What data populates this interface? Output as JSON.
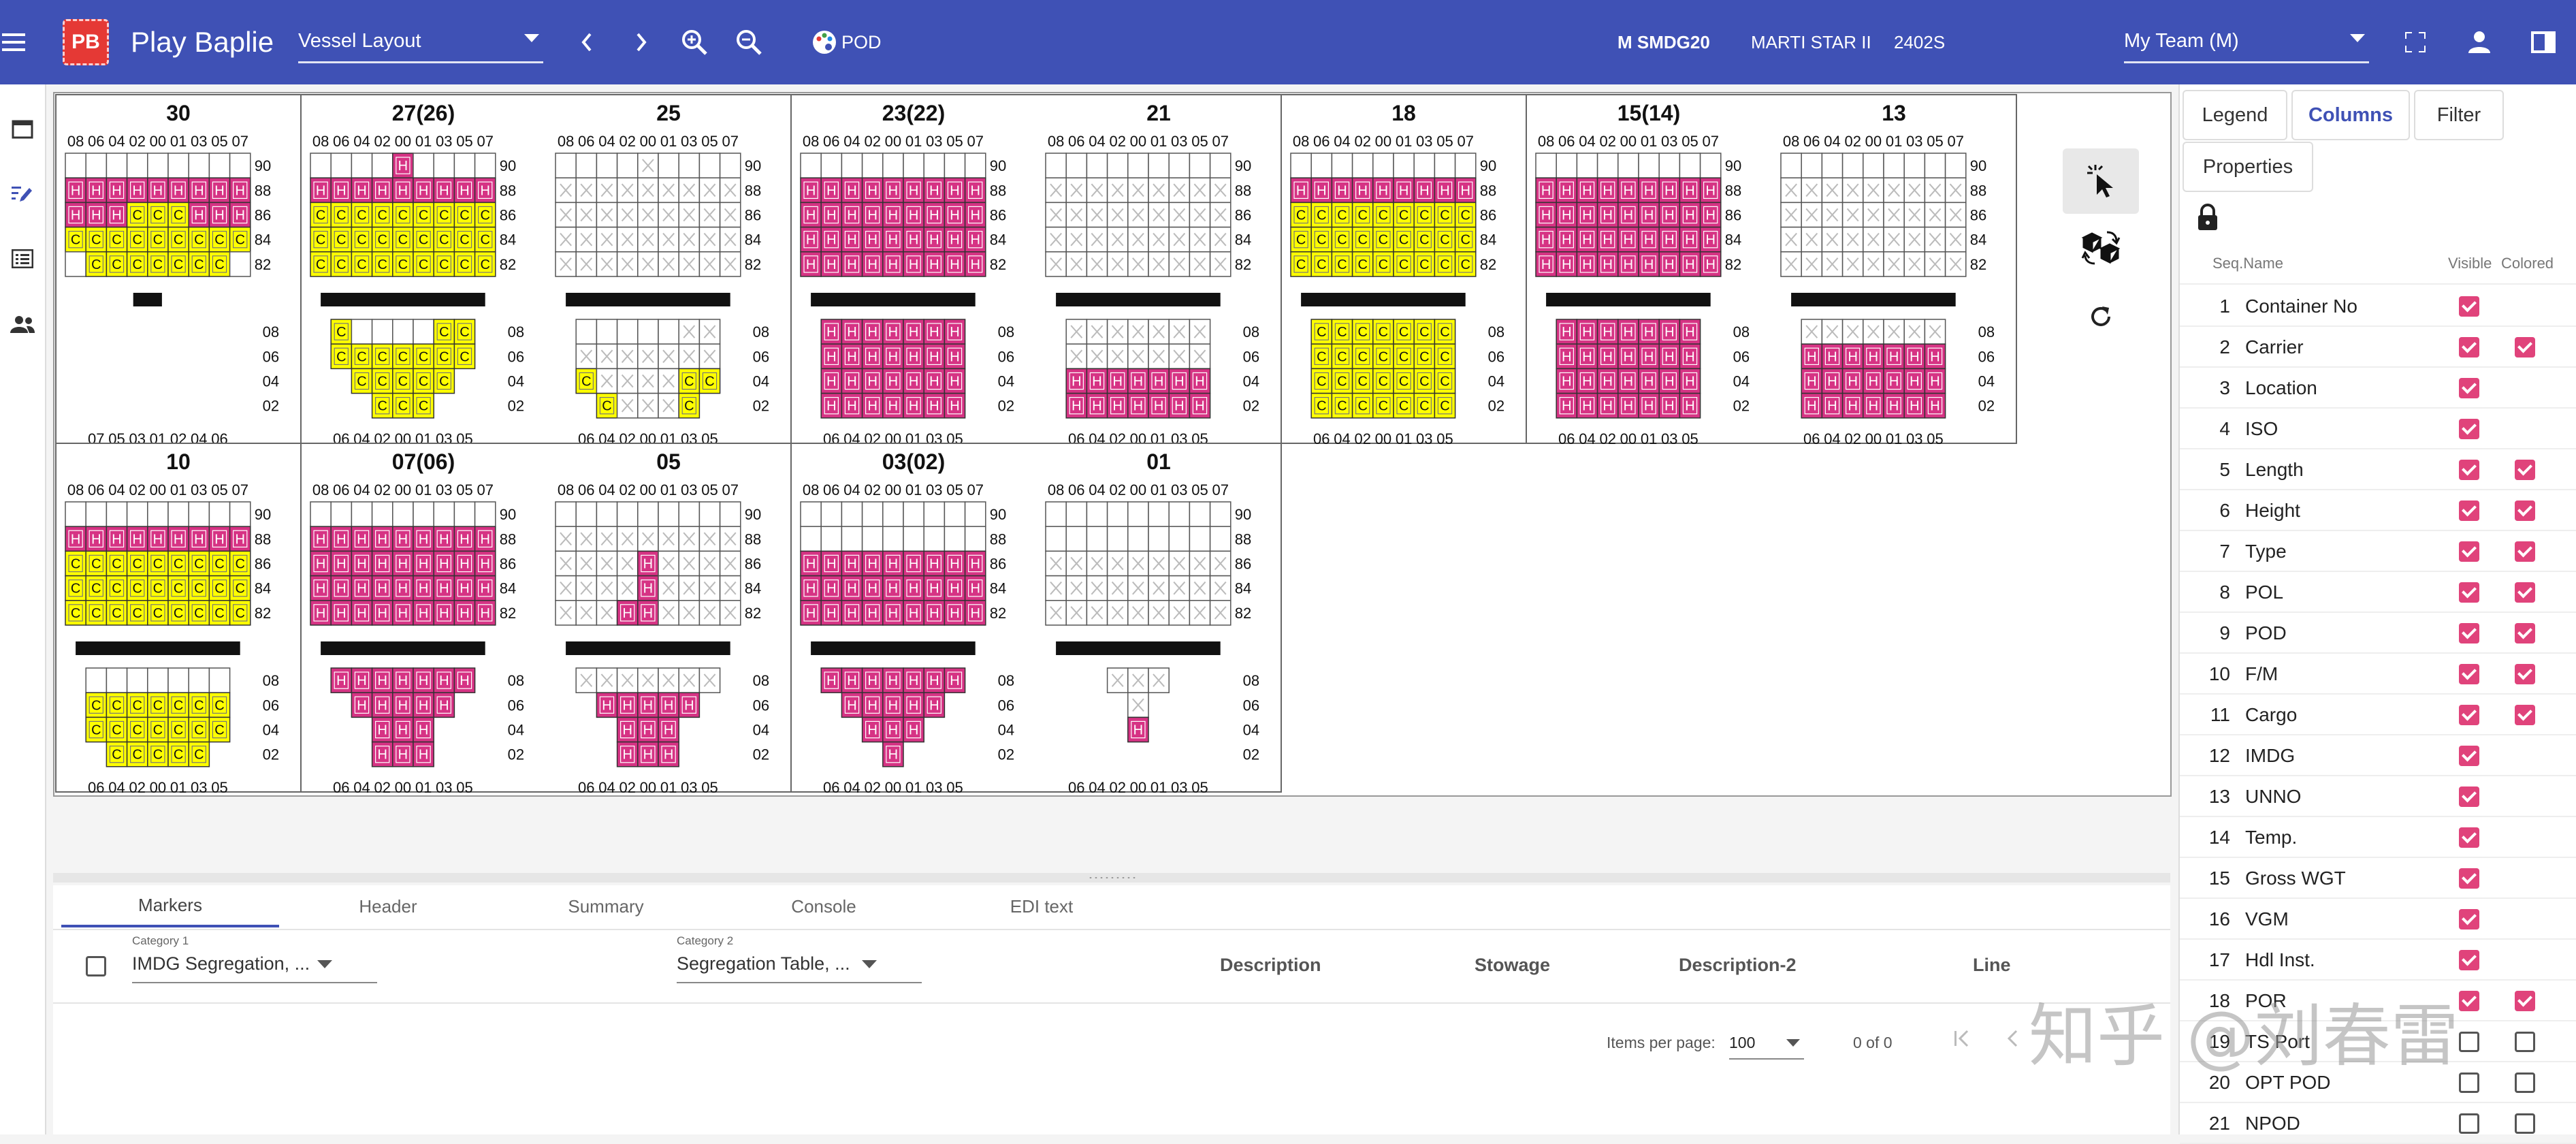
{
  "app": {
    "logo": "PB",
    "title": "Play Baplie",
    "view_select": "Vessel Layout",
    "pod_label": "POD",
    "vessel_code": "M SMDG20",
    "vessel_name": "MARTI STAR II",
    "voyage": "2402S",
    "team": "My Team (M)"
  },
  "colors": {
    "topbar": "#3f51b5",
    "hazard": "#d63384",
    "yellow": "#ffff00",
    "accent": "#e0437b"
  },
  "icons": {
    "menu": "menu-icon",
    "prev": "chevron-left-icon",
    "next": "chevron-right-icon",
    "zoom_in": "zoom-in-icon",
    "zoom_out": "zoom-out-icon",
    "palette": "palette-icon",
    "fullscreen": "fullscreen-icon",
    "user": "account-icon",
    "panel": "right-panel-icon"
  },
  "bays_row1": [
    {
      "title": "30",
      "wide": true,
      "deck": {
        "cols": [
          "08",
          "06",
          "04",
          "02",
          "00",
          "01",
          "03",
          "05",
          "07"
        ],
        "tiers": [
          "90",
          "88",
          "86",
          "84",
          "82"
        ],
        "grid": [
          "EEEEEEEEE",
          "HHHHHHHHH",
          "HHHYYYHHH",
          "YYYYYYYYY",
          "EYYYYYYYE"
        ]
      },
      "hold": {
        "cols": [
          "07",
          "05",
          "03",
          "01",
          "02",
          "04",
          "06"
        ],
        "tiers": [
          "08",
          "06",
          "04",
          "02"
        ],
        "grid": []
      }
    },
    {
      "title": "27(26)",
      "wide": false,
      "deck": {
        "cols": [
          "08",
          "06",
          "04",
          "02",
          "00",
          "01",
          "03",
          "05",
          "07"
        ],
        "tiers": [
          "90",
          "88",
          "86",
          "84",
          "82"
        ],
        "grid": [
          "EEEEHEEEE",
          "HHHHHHHHH",
          "YYYYYYYYY",
          "YYYYYYYYY",
          "YYYYYYYYY"
        ]
      },
      "hold": {
        "cols": [
          "06",
          "04",
          "02",
          "00",
          "01",
          "03",
          "05"
        ],
        "tiers": [
          "08",
          "06",
          "04",
          "02"
        ],
        "grid": [
          "YEEEEYY",
          "YYYYYYY",
          "-YYYYY-",
          "--YYY--"
        ]
      }
    },
    {
      "title": "25",
      "wide": false,
      "deck": {
        "cols": [
          "08",
          "06",
          "04",
          "02",
          "00",
          "01",
          "03",
          "05",
          "07"
        ],
        "tiers": [
          "90",
          "88",
          "86",
          "84",
          "82"
        ],
        "grid": [
          "EEEEXEEEE",
          "XXXXXXXXX",
          "XXXXXXXXX",
          "XXXXXXXXX",
          "XXXXXXXXX"
        ]
      },
      "hold": {
        "cols": [
          "06",
          "04",
          "02",
          "00",
          "01",
          "03",
          "05"
        ],
        "tiers": [
          "08",
          "06",
          "04",
          "02"
        ],
        "grid": [
          "EEEEEXX",
          "XXXXXXX",
          "YXXXXYY",
          "-YXXXY-"
        ]
      }
    },
    {
      "title": "23(22)",
      "wide": false,
      "deck": {
        "cols": [
          "08",
          "06",
          "04",
          "02",
          "00",
          "01",
          "03",
          "05",
          "07"
        ],
        "tiers": [
          "90",
          "88",
          "86",
          "84",
          "82"
        ],
        "grid": [
          "EEEEEEEEE",
          "HHHHHHHHH",
          "HHHHHHHHH",
          "HHHHHHHHH",
          "HHHHHHHHH"
        ]
      },
      "hold": {
        "cols": [
          "06",
          "04",
          "02",
          "00",
          "01",
          "03",
          "05"
        ],
        "tiers": [
          "08",
          "06",
          "04",
          "02"
        ],
        "grid": [
          "HHHHHHH",
          "HHHHHHH",
          "HHHHHHH",
          "HHHHHHH"
        ]
      }
    },
    {
      "title": "21",
      "wide": false,
      "deck": {
        "cols": [
          "08",
          "06",
          "04",
          "02",
          "00",
          "01",
          "03",
          "05",
          "07"
        ],
        "tiers": [
          "90",
          "88",
          "86",
          "84",
          "82"
        ],
        "grid": [
          "EEEEEEEEE",
          "XXXXXXXXX",
          "XXXXXXXXX",
          "XXXXXXXXX",
          "XXXXXXXXX"
        ]
      },
      "hold": {
        "cols": [
          "06",
          "04",
          "02",
          "00",
          "01",
          "03",
          "05"
        ],
        "tiers": [
          "08",
          "06",
          "04",
          "02"
        ],
        "grid": [
          "XXXXXXX",
          "XXXXXXX",
          "HHHHHHH",
          "HHHHHHH"
        ]
      }
    },
    {
      "title": "18",
      "wide": true,
      "deck": {
        "cols": [
          "08",
          "06",
          "04",
          "02",
          "00",
          "01",
          "03",
          "05",
          "07"
        ],
        "tiers": [
          "90",
          "88",
          "86",
          "84",
          "82"
        ],
        "grid": [
          "EEEEEEEEE",
          "HHHHHHHHH",
          "YYYYYYYYY",
          "YYYYYYYYY",
          "YYYYYYYYY"
        ]
      },
      "hold": {
        "cols": [
          "06",
          "04",
          "02",
          "00",
          "01",
          "03",
          "05"
        ],
        "tiers": [
          "08",
          "06",
          "04",
          "02"
        ],
        "grid": [
          "YYYYYYY",
          "YYYYYYY",
          "YYYYYYY",
          "YYYYYYY"
        ]
      }
    },
    {
      "title": "15(14)",
      "wide": false,
      "deck": {
        "cols": [
          "08",
          "06",
          "04",
          "02",
          "00",
          "01",
          "03",
          "05",
          "07"
        ],
        "tiers": [
          "90",
          "88",
          "86",
          "84",
          "82"
        ],
        "grid": [
          "EEEEEEEEE",
          "HHHHHHHHH",
          "HHHHHHHHH",
          "HHHHHHHHH",
          "HHHHHHHHH"
        ]
      },
      "hold": {
        "cols": [
          "06",
          "04",
          "02",
          "00",
          "01",
          "03",
          "05"
        ],
        "tiers": [
          "08",
          "06",
          "04",
          "02"
        ],
        "grid": [
          "HHHHHHH",
          "HHHHHHH",
          "HHHHHHH",
          "HHHHHHH"
        ]
      }
    },
    {
      "title": "13",
      "wide": false,
      "deck": {
        "cols": [
          "08",
          "06",
          "04",
          "02",
          "00",
          "01",
          "03",
          "05",
          "07"
        ],
        "tiers": [
          "90",
          "88",
          "86",
          "84",
          "82"
        ],
        "grid": [
          "EEEEEEEEE",
          "XXXXXXXXX",
          "XXXXXXXXX",
          "XXXXXXXXX",
          "XXXXXXXXX"
        ]
      },
      "hold": {
        "cols": [
          "06",
          "04",
          "02",
          "00",
          "01",
          "03",
          "05"
        ],
        "tiers": [
          "08",
          "06",
          "04",
          "02"
        ],
        "grid": [
          "XXXXXXX",
          "HHHHHHH",
          "HHHHHHH",
          "HHHHHHH"
        ]
      }
    }
  ],
  "bays_row2": [
    {
      "title": "10",
      "wide": true,
      "deck": {
        "cols": [
          "08",
          "06",
          "04",
          "02",
          "00",
          "01",
          "03",
          "05",
          "07"
        ],
        "tiers": [
          "90",
          "88",
          "86",
          "84",
          "82"
        ],
        "grid": [
          "EEEEEEEEE",
          "HHHHHHHHH",
          "YYYYYYYYY",
          "YYYYYYYYY",
          "YYYYYYYYY"
        ]
      },
      "hold": {
        "cols": [
          "06",
          "04",
          "02",
          "00",
          "01",
          "03",
          "05"
        ],
        "tiers": [
          "08",
          "06",
          "04",
          "02"
        ],
        "grid": [
          "EEEEEEE",
          "YYYYYYY",
          "YYYYYYY",
          "-YYYYY-"
        ]
      }
    },
    {
      "title": "07(06)",
      "wide": false,
      "deck": {
        "cols": [
          "08",
          "06",
          "04",
          "02",
          "00",
          "01",
          "03",
          "05",
          "07"
        ],
        "tiers": [
          "90",
          "88",
          "86",
          "84",
          "82"
        ],
        "grid": [
          "EEEEEEEEE",
          "HHHHHHHHH",
          "HHHHHHHHH",
          "HHHHHHHHH",
          "HHHHHHHHH"
        ]
      },
      "hold": {
        "cols": [
          "06",
          "04",
          "02",
          "00",
          "01",
          "03",
          "05"
        ],
        "tiers": [
          "08",
          "06",
          "04",
          "02"
        ],
        "grid": [
          "HHHHHHH",
          "-HHHHH-",
          "--HHH--",
          "--HHH--"
        ]
      }
    },
    {
      "title": "05",
      "wide": false,
      "deck": {
        "cols": [
          "08",
          "06",
          "04",
          "02",
          "00",
          "01",
          "03",
          "05",
          "07"
        ],
        "tiers": [
          "90",
          "88",
          "86",
          "84",
          "82"
        ],
        "grid": [
          "EEEEEEEEE",
          "XXXXXXXXX",
          "XXXXHXXXX",
          "XXXXHXXXX",
          "XXXHHXXXX"
        ]
      },
      "hold": {
        "cols": [
          "06",
          "04",
          "02",
          "00",
          "01",
          "03",
          "05"
        ],
        "tiers": [
          "08",
          "06",
          "04",
          "02"
        ],
        "grid": [
          "XXXXXXX",
          "-HHHHH-",
          "--HHH--",
          "--HHH--"
        ]
      }
    },
    {
      "title": "03(02)",
      "wide": false,
      "deck": {
        "cols": [
          "08",
          "06",
          "04",
          "02",
          "00",
          "01",
          "03",
          "05",
          "07"
        ],
        "tiers": [
          "90",
          "88",
          "86",
          "84",
          "82"
        ],
        "grid": [
          "EEEEEEEEE",
          "EEEEEEEEE",
          "HHHHHHHHH",
          "HHHHHHHHH",
          "HHHHHHHHH"
        ]
      },
      "hold": {
        "cols": [
          "06",
          "04",
          "02",
          "00",
          "01",
          "03",
          "05"
        ],
        "tiers": [
          "08",
          "06",
          "04",
          "02"
        ],
        "grid": [
          "HHHHHHH",
          "-HHHHH-",
          "--HHH--",
          "---H---"
        ]
      }
    },
    {
      "title": "01",
      "wide": false,
      "deck": {
        "cols": [
          "08",
          "06",
          "04",
          "02",
          "00",
          "01",
          "03",
          "05",
          "07"
        ],
        "tiers": [
          "90",
          "88",
          "86",
          "84",
          "82"
        ],
        "grid": [
          "EEEEEEEEE",
          "EEEEEEEEE",
          "XXXXXXXXX",
          "XXXXXXXXX",
          "XXXXXXXXX"
        ]
      },
      "hold": {
        "cols": [
          "06",
          "04",
          "02",
          "00",
          "01",
          "03",
          "05"
        ],
        "tiers": [
          "08",
          "06",
          "04",
          "02"
        ],
        "grid": [
          "--XXX--",
          "---X---",
          "---H---",
          "-------"
        ]
      }
    }
  ],
  "bottom": {
    "tabs": [
      "Markers",
      "Header",
      "Summary",
      "Console",
      "EDI text"
    ],
    "cat1_label": "Category 1",
    "cat1_value": "IMDG Segregation, ...",
    "cat2_label": "Category 2",
    "cat2_value": "Segregation Table, ...",
    "columns": [
      "Description",
      "Stowage",
      "Description-2",
      "Line"
    ],
    "items_per_page_label": "Items per page:",
    "items_per_page": "100",
    "range": "0 of 0"
  },
  "right": {
    "buttons": [
      "Legend",
      "Columns",
      "Filter",
      "Properties"
    ],
    "header_seq": "Seq.Name",
    "header_visible": "Visible",
    "header_colored": "Colored",
    "rows": [
      {
        "seq": "1",
        "name": "Container No",
        "visible": true,
        "colored": null
      },
      {
        "seq": "2",
        "name": "Carrier",
        "visible": true,
        "colored": true
      },
      {
        "seq": "3",
        "name": "Location",
        "visible": true,
        "colored": null
      },
      {
        "seq": "4",
        "name": "ISO",
        "visible": true,
        "colored": null
      },
      {
        "seq": "5",
        "name": "Length",
        "visible": true,
        "colored": true
      },
      {
        "seq": "6",
        "name": "Height",
        "visible": true,
        "colored": true
      },
      {
        "seq": "7",
        "name": "Type",
        "visible": true,
        "colored": true
      },
      {
        "seq": "8",
        "name": "POL",
        "visible": true,
        "colored": true
      },
      {
        "seq": "9",
        "name": "POD",
        "visible": true,
        "colored": true
      },
      {
        "seq": "10",
        "name": "F/M",
        "visible": true,
        "colored": true
      },
      {
        "seq": "11",
        "name": "Cargo",
        "visible": true,
        "colored": true
      },
      {
        "seq": "12",
        "name": "IMDG",
        "visible": true,
        "colored": null
      },
      {
        "seq": "13",
        "name": "UNNO",
        "visible": true,
        "colored": null
      },
      {
        "seq": "14",
        "name": "Temp.",
        "visible": true,
        "colored": null
      },
      {
        "seq": "15",
        "name": "Gross WGT",
        "visible": true,
        "colored": null
      },
      {
        "seq": "16",
        "name": "VGM",
        "visible": true,
        "colored": null
      },
      {
        "seq": "17",
        "name": "Hdl Inst.",
        "visible": true,
        "colored": null
      },
      {
        "seq": "18",
        "name": "POR",
        "visible": true,
        "colored": true
      },
      {
        "seq": "19",
        "name": "TS Port",
        "visible": false,
        "colored": false
      },
      {
        "seq": "20",
        "name": "OPT POD",
        "visible": false,
        "colored": false
      },
      {
        "seq": "21",
        "name": "NPOD",
        "visible": false,
        "colored": false
      }
    ]
  },
  "watermark": "知乎 @刘春雷"
}
